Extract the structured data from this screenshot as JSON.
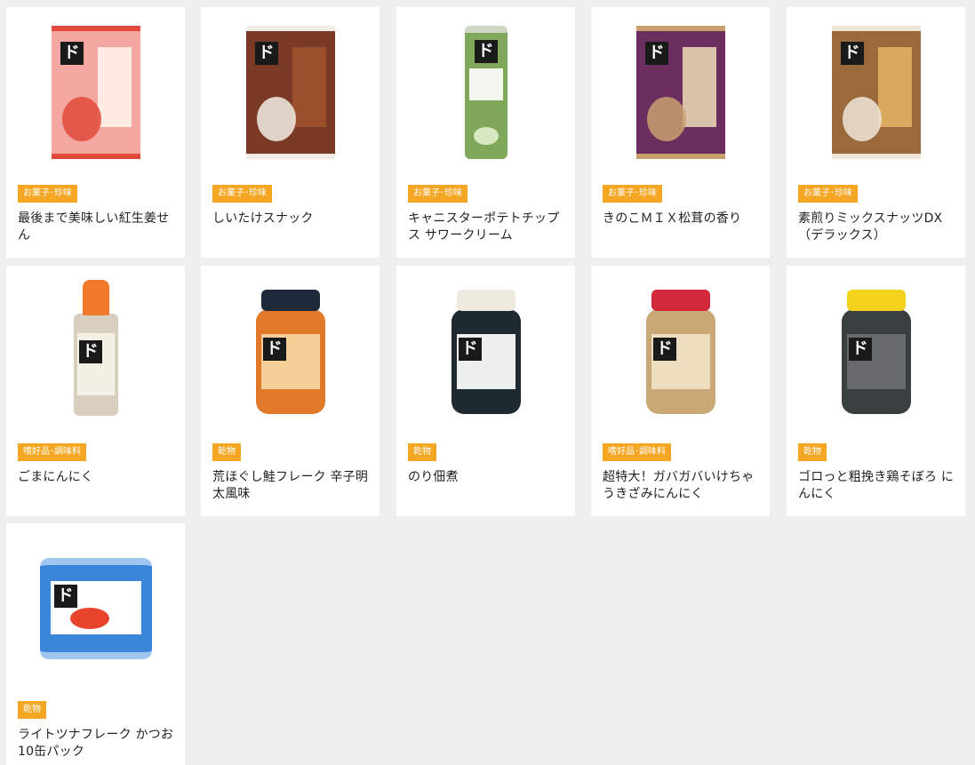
{
  "products": [
    {
      "category": "お菓子･珍味",
      "name": "最後まで美味しい紅生姜せん",
      "colors": {
        "body": "#f4a6a0",
        "accent": "#e14a3b",
        "label": "#fff3e8"
      },
      "shape": "bag",
      "icon": "product-bag-icon"
    },
    {
      "category": "お菓子･珍味",
      "name": "しいたけスナック",
      "colors": {
        "body": "#7a3a26",
        "accent": "#f2ede4",
        "label": "#a0522d"
      },
      "shape": "bag",
      "icon": "product-bag-icon"
    },
    {
      "category": "お菓子･珍味",
      "name": "キャニスターポテトチップス サワークリーム",
      "colors": {
        "body": "#7fa85a",
        "accent": "#d9e8c0",
        "label": "#ffffff"
      },
      "shape": "canister",
      "icon": "product-canister-icon"
    },
    {
      "category": "お菓子･珍味",
      "name": "きのこＭＩＸ松茸の香り",
      "colors": {
        "body": "#6b2e5e",
        "accent": "#c8a070",
        "label": "#e7d3b3"
      },
      "shape": "bag",
      "icon": "product-bag-icon"
    },
    {
      "category": "お菓子･珍味",
      "name": "素煎りミックスナッツDX（デラックス）",
      "colors": {
        "body": "#9a6a3c",
        "accent": "#f0e6d8",
        "label": "#e0b060"
      },
      "shape": "bag",
      "icon": "product-bag-icon"
    },
    {
      "category": "嗜好品･調味料",
      "name": "ごまにんにく",
      "colors": {
        "body": "#d8cfc0",
        "accent": "#f07a2a",
        "label": "#f5f0e6"
      },
      "shape": "bottle",
      "icon": "product-bottle-icon"
    },
    {
      "category": "乾物",
      "name": "荒ほぐし鮭フレーク 辛子明太風味",
      "colors": {
        "body": "#e07a2a",
        "accent": "#1c2a3a",
        "label": "#f7d6a2"
      },
      "shape": "jar",
      "icon": "product-jar-icon"
    },
    {
      "category": "乾物",
      "name": "のり佃煮",
      "colors": {
        "body": "#1f2a30",
        "accent": "#efeae0",
        "label": "#ffffff"
      },
      "shape": "jar",
      "icon": "product-jar-icon"
    },
    {
      "category": "嗜好品･調味料",
      "name": "超特大！ガバガバいけちゃうきざみにんにく",
      "colors": {
        "body": "#c9a876",
        "accent": "#d1283a",
        "label": "#f1e2c4"
      },
      "shape": "jar",
      "icon": "product-jar-icon"
    },
    {
      "category": "乾物",
      "name": "ゴロっと粗挽き鶏そぼろ にんにく",
      "colors": {
        "body": "#3a3f40",
        "accent": "#f2d21a",
        "label": "#6b6f70"
      },
      "shape": "jar",
      "icon": "product-jar-icon"
    },
    {
      "category": "乾物",
      "name": "ライトツナフレーク かつお 10缶パック",
      "colors": {
        "body": "#3a86d8",
        "accent": "#ffffff",
        "label": "#e8442c"
      },
      "shape": "cans",
      "icon": "product-cans-icon"
    }
  ],
  "badge_color": "#f5a623",
  "page_background": "#efefef",
  "do_mark": "ド"
}
